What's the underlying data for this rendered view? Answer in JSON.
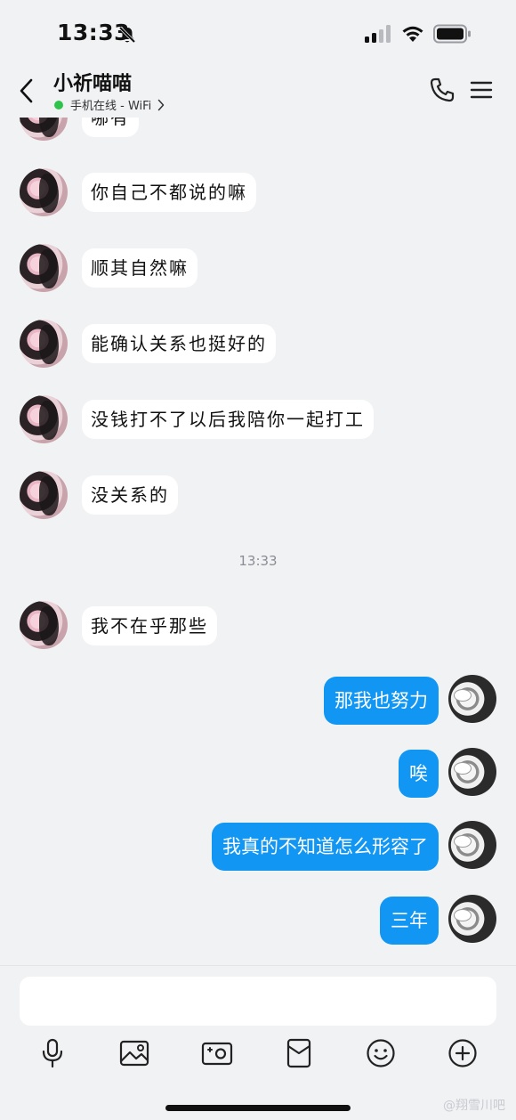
{
  "status_bar": {
    "time": "13:33"
  },
  "header": {
    "contact_name": "小祈喵喵",
    "presence_text": "手机在线 - WiFi"
  },
  "chat": {
    "partial_top_message": "哪有",
    "incoming": [
      "你自己不都说的嘛",
      "顺其自然嘛",
      "能确认关系也挺好的",
      "没钱打不了以后我陪你一起打工",
      "没关系的"
    ],
    "timestamp": "13:33",
    "incoming_after": [
      "我不在乎那些"
    ],
    "outgoing": [
      "那我也努力",
      "唉",
      "我真的不知道怎么形容了",
      "三年"
    ]
  },
  "input": {
    "value": "",
    "placeholder": ""
  },
  "toolbar": {
    "icons": [
      "microphone-icon",
      "image-icon",
      "camera-icon",
      "red-packet-icon",
      "emoji-icon",
      "plus-icon"
    ]
  },
  "watermark": "@翔雪川吧",
  "colors": {
    "background": "#f1f2f4",
    "outgoing_bubble": "#1196f4",
    "incoming_bubble": "#ffffff",
    "online_dot": "#2ec44b",
    "timestamp": "#8a8d93"
  }
}
